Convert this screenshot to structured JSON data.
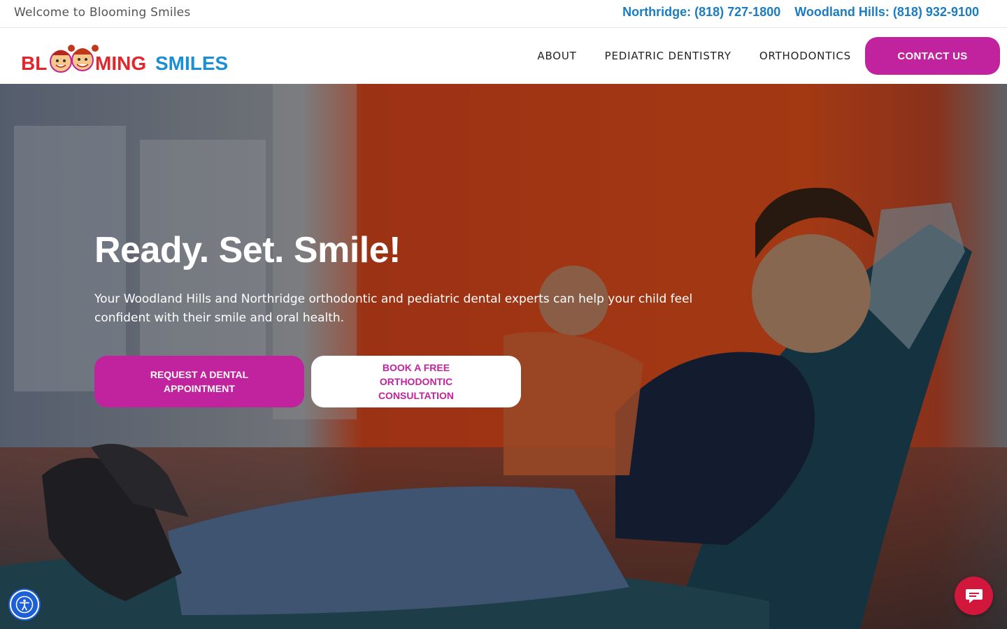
{
  "topbar": {
    "welcome": "Welcome to Blooming Smiles",
    "phones": [
      {
        "label": "Northridge: (818) 727-1800"
      },
      {
        "label": "Woodland Hills: (818) 932-9100"
      }
    ]
  },
  "logo": {
    "text_part1": "BL",
    "text_part2": "MING",
    "text_part3": "SMILES",
    "alt": "Blooming Smiles"
  },
  "nav": {
    "items": [
      "ABOUT",
      "PEDIATRIC DENTISTRY",
      "ORTHODONTICS"
    ],
    "contact_label": "CONTACT US"
  },
  "hero": {
    "title": "Ready. Set. Smile!",
    "text": "Your Woodland Hills and Northridge orthodontic and pediatric dental experts can help your child feel confident with their smile and oral health.",
    "primary_button": "REQUEST A DENTAL APPOINTMENT",
    "secondary_button": "BOOK A FREE ORTHODONTIC CONSULTATION"
  },
  "widgets": {
    "accessibility_icon": "accessibility-icon",
    "chat_icon": "chat-icon"
  },
  "colors": {
    "accent": "#c1239e",
    "phone_link": "#1a7cc2",
    "chat": "#d1183c",
    "accessibility": "#1d5fd6"
  }
}
